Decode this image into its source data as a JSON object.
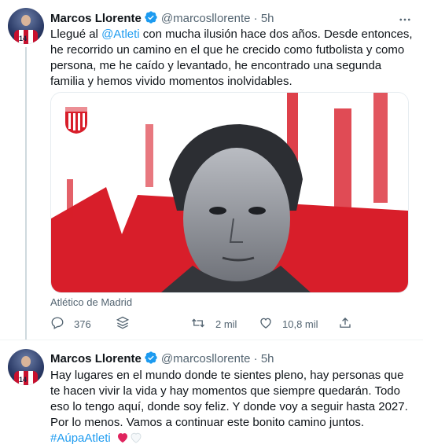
{
  "tweet1": {
    "author": {
      "name": "Marcos Llorente",
      "handle": "@marcosllorente",
      "separator": "·",
      "time": "5h",
      "avatar_number": "14"
    },
    "text": {
      "prefix": "Llegué al ",
      "mention": "@Atleti",
      "rest": " con mucha ilusión hace dos años. Desde entonces, he recorrido un camino en el que he crecido como futbolista y como persona, me he caído y levantado, he encontrado una segunda familia y hemos vivido momentos inolvidables."
    },
    "media_caption": "Atlético de Madrid",
    "actions": {
      "replies": "376",
      "retweets": "2 mil",
      "likes": "10,8 mil"
    }
  },
  "tweet2": {
    "author": {
      "name": "Marcos Llorente",
      "handle": "@marcosllorente",
      "separator": "·",
      "time": "5h",
      "avatar_number": "14"
    },
    "text": "Hay lugares en el mundo donde te sientes pleno, hay personas que te hacen vivir la vida y hay momentos que siempre quedarán. Todo eso lo tengo aquí, donde soy feliz. Y donde voy a seguir hasta 2027. Por lo menos. Vamos a continuar este bonito camino juntos.",
    "hashtag": "#AúpaAtleti"
  },
  "colors": {
    "accent": "#1d9bf0",
    "atleti_red": "#d81e2a",
    "muted": "#536471"
  },
  "icons": [
    "verified-badge-icon",
    "more-options-icon",
    "reply-icon",
    "stack-icon",
    "retweet-icon",
    "like-icon",
    "share-icon",
    "red-heart-icon",
    "white-heart-icon",
    "atleti-crest-icon"
  ]
}
